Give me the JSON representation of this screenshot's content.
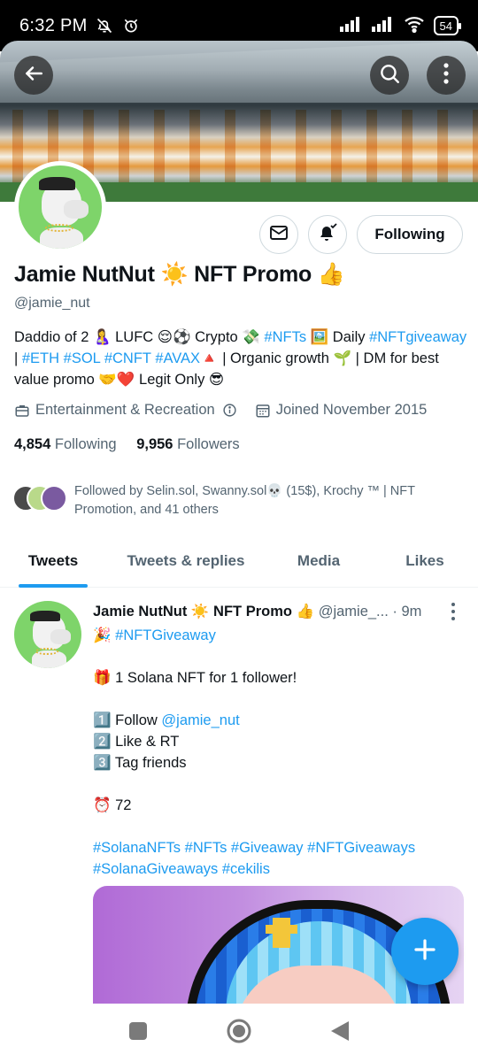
{
  "status_bar": {
    "time": "6:32 PM",
    "battery": "54",
    "icons": [
      "bell-off-icon",
      "alarm-icon",
      "signal-icon",
      "signal-icon",
      "wifi-icon",
      "battery-icon"
    ]
  },
  "profile": {
    "name_parts": [
      "Jamie NutNut ",
      "☀️",
      " NFT Promo ",
      "👍"
    ],
    "handle": "@jamie_nut",
    "bio": [
      {
        "t": "Daddio of 2 🤱 LUFC 😌⚽ Crypto 💸 ",
        "link": false
      },
      {
        "t": "#NFTs",
        "link": true
      },
      {
        "t": " 🖼️ Daily ",
        "link": false
      },
      {
        "t": "#NFTgiveaway",
        "link": true
      },
      {
        "t": " | ",
        "link": false
      },
      {
        "t": "#ETH",
        "link": true
      },
      {
        "t": " ",
        "link": false
      },
      {
        "t": "#SOL",
        "link": true
      },
      {
        "t": " ",
        "link": false
      },
      {
        "t": "#CNFT",
        "link": true
      },
      {
        "t": " ",
        "link": false
      },
      {
        "t": "#AVAX",
        "link": true
      },
      {
        "t": "🔺 |  Organic growth 🌱 | DM for best value promo 🤝❤️ Legit Only 😎",
        "link": false
      }
    ],
    "category": "Entertainment & Recreation",
    "joined": "Joined November 2015",
    "following_count": "4,854",
    "following_label": "Following",
    "followers_count": "9,956",
    "followers_label": "Followers",
    "followed_by": "Followed by Selin.sol, Swanny.sol💀 (15$), Krochy ™ | NFT Promotion, and 41 others",
    "follow_button": "Following"
  },
  "tabs": [
    "Tweets",
    "Tweets & replies",
    "Media",
    "Likes"
  ],
  "active_tab": 0,
  "tweet": {
    "author": "Jamie NutNut ☀️ NFT Promo 👍",
    "handle": "@jamie_...",
    "time": "· 9m",
    "lines": [
      {
        "parts": [
          {
            "t": "🎉 ",
            "link": false
          },
          {
            "t": "#NFTGiveaway",
            "link": true
          }
        ]
      },
      {
        "gap": true
      },
      {
        "parts": [
          {
            "t": "🎁 1 Solana NFT for 1 follower!",
            "link": false
          }
        ]
      },
      {
        "gap": true
      },
      {
        "parts": [
          {
            "t": "1️⃣ Follow ",
            "link": false
          },
          {
            "t": "@jamie_nut",
            "link": true
          }
        ]
      },
      {
        "parts": [
          {
            "t": "2️⃣ Like & RT",
            "link": false
          }
        ]
      },
      {
        "parts": [
          {
            "t": "3️⃣ Tag friends",
            "link": false
          }
        ]
      },
      {
        "gap": true
      },
      {
        "parts": [
          {
            "t": "⏰ 72",
            "link": false
          }
        ]
      },
      {
        "gap": true
      },
      {
        "parts": [
          {
            "t": "#SolanaNFTs",
            "link": true
          },
          {
            "t": " ",
            "link": false
          },
          {
            "t": "#NFTs",
            "link": true
          },
          {
            "t": " ",
            "link": false
          },
          {
            "t": "#Giveaway",
            "link": true
          },
          {
            "t": " ",
            "link": false
          },
          {
            "t": "#NFTGiveaways",
            "link": true
          }
        ]
      },
      {
        "parts": [
          {
            "t": "#SolanaGiveaways",
            "link": true
          },
          {
            "t": " ",
            "link": false
          },
          {
            "t": "#cekilis",
            "link": true
          }
        ]
      }
    ]
  },
  "colors": {
    "accent": "#1d9bf0",
    "muted": "#536471",
    "text": "#0f1419"
  }
}
